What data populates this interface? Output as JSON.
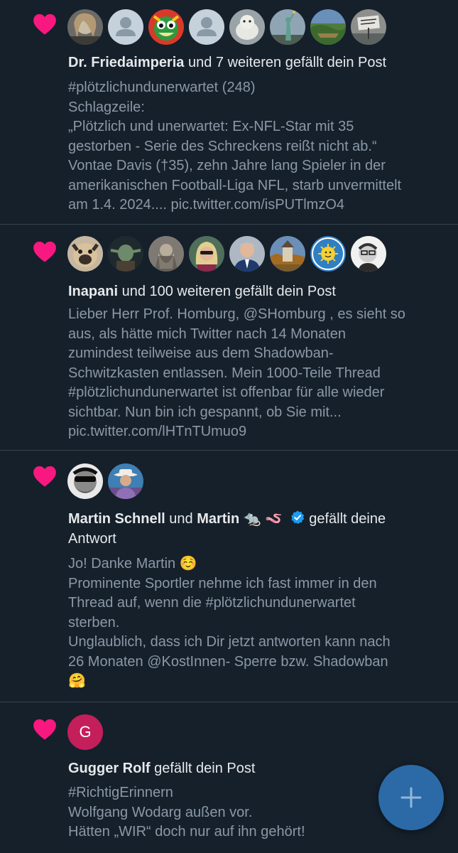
{
  "colors": {
    "background": "#15202b",
    "heart": "#f91880",
    "text_primary": "#e7e9ea",
    "text_secondary": "#8b98a5",
    "divider": "#38444d",
    "verified": "#1d9bf0",
    "fab": "#2b6aa6"
  },
  "notifications": [
    {
      "icon": "heart-icon",
      "avatars": [
        "avatar-woman-blonde",
        "avatar-default-placeholder",
        "avatar-cartoon-monster",
        "avatar-default-placeholder",
        "avatar-plush-toy",
        "avatar-statue-of-liberty",
        "avatar-landscape",
        "avatar-sign"
      ],
      "actor": "Dr. Friedaimperia",
      "action": " und 7 weiteren gefällt dein Post",
      "lines": [
        "#plötzlichundunerwartet (248)",
        "Schlagzeile:",
        "„Plötzlich und unerwartet: Ex-NFL-Star mit 35",
        "gestorben - Serie des Schreckens reißt nicht ab.“",
        "Vontae Davis (†35), zehn Jahre lang Spieler in der",
        "amerikanischen Football-Liga NFL, starb unvermittelt",
        "am 1.4. 2024.... pic.twitter.com/isPUTlmzO4"
      ]
    },
    {
      "icon": "heart-icon",
      "avatars": [
        "avatar-pug",
        "avatar-yoda",
        "avatar-wizard",
        "avatar-woman-sunglasses",
        "avatar-man-suit",
        "avatar-castle",
        "avatar-kernkraft-badge",
        "avatar-man-glasses"
      ],
      "actor": "Inapani",
      "action": " und 100 weiteren gefällt dein Post",
      "lines": [
        "Lieber Herr Prof. Homburg, @SHomburg , es sieht so",
        "aus, als hätte mich Twitter nach 14 Monaten",
        "zumindest teilweise aus dem Shadowban-",
        "Schwitzkasten entlassen. Mein 1000-Teile Thread",
        "#plötzlichundunerwartet ist offenbar für alle wieder",
        "sichtbar. Nun bin ich gespannt, ob Sie mit...",
        "pic.twitter.com/lHTnTUmuo9"
      ]
    },
    {
      "icon": "heart-icon",
      "avatars": [
        "avatar-man-sunglasses",
        "avatar-man-cowboy-hat"
      ],
      "actor": "Martin Schnell",
      "connector": " und ",
      "actor2": "Martin 🐀 🪱",
      "action": " gefällt deine",
      "action2": "Antwort",
      "lines": [
        "Jo! Danke Martin ☺️",
        "Prominente Sportler nehme ich fast immer in den",
        "Thread auf, wenn die #plötzlichundunerwartet",
        "sterben.",
        "Unglaublich, dass ich Dir jetzt antworten kann nach",
        "26 Monaten @KostInnen- Sperre bzw. Shadowban",
        "🤗"
      ]
    },
    {
      "icon": "heart-icon",
      "avatar_letter": "G",
      "actor": "Gugger Rolf",
      "action": " gefällt dein Post",
      "lines": [
        "#RichtigErinnern",
        "Wolfgang Wodarg außen vor.",
        "Hätten „WIR“ doch nur auf ihn gehört!"
      ]
    }
  ],
  "fab": {
    "icon": "plus-icon"
  }
}
